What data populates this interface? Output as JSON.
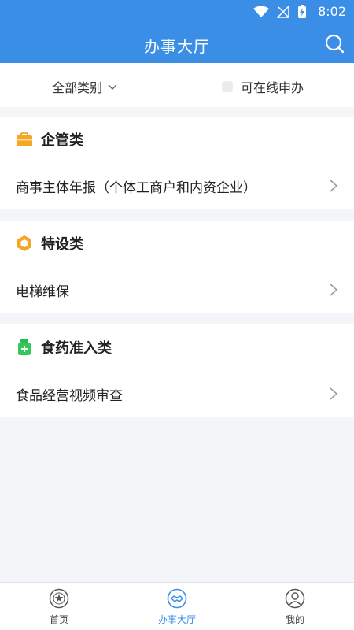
{
  "status_bar": {
    "time": "8:02",
    "icons": [
      "wifi-icon",
      "no-signal-icon",
      "battery-charging-icon"
    ]
  },
  "header": {
    "title": "办事大厅",
    "search_icon": "search-icon"
  },
  "filter": {
    "category_label": "全部类别",
    "online_label": "可在线申办",
    "online_checked": false
  },
  "sections": [
    {
      "title": "企管类",
      "icon": "briefcase-icon",
      "icon_color": "#f5a623",
      "item": "商事主体年报（个体工商户和内资企业）"
    },
    {
      "title": "特设类",
      "icon": "hexagon-icon",
      "icon_color": "#f5a623",
      "item": "电梯维保"
    },
    {
      "title": "食药准入类",
      "icon": "medicine-bottle-icon",
      "icon_color": "#34c759",
      "item": "食品经营视频审查"
    }
  ],
  "tabbar": {
    "tabs": [
      {
        "label": "首页",
        "icon": "emblem-icon",
        "active": false
      },
      {
        "label": "办事大厅",
        "icon": "handshake-icon",
        "active": true
      },
      {
        "label": "我的",
        "icon": "user-icon",
        "active": false
      }
    ]
  },
  "colors": {
    "primary": "#3a8ee6",
    "background": "#f3f5f8",
    "accent_orange": "#f5a623",
    "accent_green": "#34c759"
  }
}
